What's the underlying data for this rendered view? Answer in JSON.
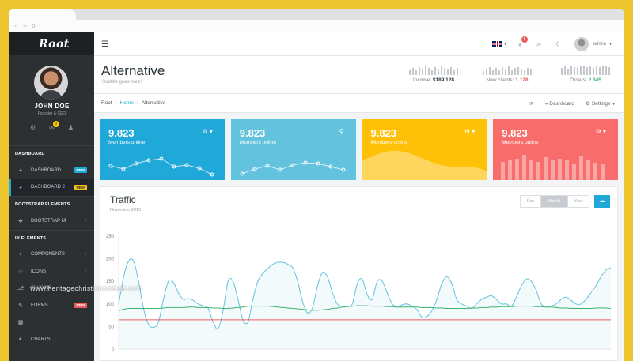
{
  "sidebar": {
    "brand": "Root",
    "profile": {
      "name": "JOHN DOE",
      "role": "Founder & CEO",
      "notification_count": "3"
    },
    "sections": [
      {
        "label": "DASHBOARD"
      },
      {
        "label": "BOOTSTRAP ELEMENTS"
      },
      {
        "label": "UI ELEMENTS"
      }
    ],
    "items": [
      {
        "label": "DASHBOARD",
        "tag": "NEW",
        "tag_color": "#20a8d8",
        "icon": "dashboard-icon"
      },
      {
        "label": "DASHBOARD 2",
        "tag": "NEW",
        "tag_color": "#f0c419",
        "icon": "dashboard-icon"
      },
      {
        "label": "BOOTSTRAP UI",
        "icon": "puzzle-icon"
      },
      {
        "label": "COMPONENTS",
        "icon": "tag-icon"
      },
      {
        "label": "ICONS",
        "icon": "star-icon"
      },
      {
        "label": "PLUGINS",
        "icon": "plug-icon"
      },
      {
        "label": "FORMS",
        "tag": "NEW",
        "tag_color": "#e85c5c",
        "icon": "edit-icon"
      },
      {
        "label": "CHARTS",
        "icon": "chart-icon"
      }
    ]
  },
  "topbar": {
    "notification_count": "5",
    "username": "admin"
  },
  "header": {
    "title": "Alternative",
    "subtitle": "Subtitle goes here!",
    "stats": [
      {
        "label": "Income:",
        "value": "$189.128",
        "color": "#263238"
      },
      {
        "label": "New clients:",
        "value": "1.128",
        "color": "#e85c5c"
      },
      {
        "label": "Orders:",
        "value": "2.345",
        "color": "#3cb371"
      }
    ]
  },
  "breadcrumb": {
    "items": [
      "Root",
      "Home",
      "Alternative"
    ],
    "actions": [
      "Dashboard",
      "Settings"
    ]
  },
  "cards": [
    {
      "value": "9.823",
      "label": "Members online",
      "color": "#20a8d8",
      "icon": "gear-icon"
    },
    {
      "value": "9.823",
      "label": "Members online",
      "color": "#63c2de",
      "icon": "location-pin-icon"
    },
    {
      "value": "9.823",
      "label": "Members online",
      "color": "#ffc107",
      "icon": "gear-icon"
    },
    {
      "value": "9.823",
      "label": "Members online",
      "color": "#f86c6b",
      "icon": "gear-icon"
    }
  ],
  "traffic": {
    "title": "Traffic",
    "subtitle": "November 2015",
    "ranges": [
      "Day",
      "Month",
      "Year"
    ],
    "selected_range": "Month"
  },
  "watermark": "www.heritagechristiancollege.com",
  "chart_data": {
    "type": "line",
    "ylim": [
      0,
      250
    ],
    "yticks": [
      0,
      50,
      100,
      150,
      200,
      250
    ],
    "x": [
      0,
      1,
      2,
      3,
      4,
      5,
      6,
      7,
      8,
      9,
      10,
      11,
      12,
      13,
      14,
      15,
      16,
      17,
      18,
      19,
      20,
      21,
      22,
      23,
      24,
      25,
      26,
      27,
      28,
      29,
      30,
      31,
      32,
      33,
      34,
      35,
      36,
      37,
      38,
      39,
      40,
      41,
      42,
      43,
      44,
      45,
      46,
      47,
      48,
      49,
      50,
      51,
      52,
      53,
      54,
      55,
      56,
      57,
      58,
      59,
      60,
      61,
      62,
      63,
      64,
      65,
      66,
      67,
      68,
      69,
      70,
      71,
      72,
      73,
      74,
      75,
      76,
      77,
      78,
      79,
      80,
      81,
      82,
      83,
      84,
      85,
      86,
      87,
      88,
      89,
      90,
      91,
      92,
      93,
      94,
      95,
      96,
      97,
      98,
      99
    ],
    "series": [
      {
        "values": [
          100,
          160,
          195,
          195,
          150,
          90,
          55,
          48,
          60,
          110,
          150,
          148,
          125,
          110,
          112,
          108,
          100,
          96,
          90,
          60,
          45,
          85,
          150,
          150,
          110,
          65,
          60,
          110,
          150,
          168,
          178,
          188,
          192,
          192,
          188,
          180,
          150,
          105,
          80,
          92,
          140,
          170,
          160,
          125,
          100,
          95,
          95,
          100,
          145,
          155,
          120,
          110,
          150,
          150,
          125,
          100,
          95,
          98,
          100,
          95,
          88,
          70,
          72,
          85,
          110,
          145,
          160,
          145,
          110,
          100,
          95,
          90,
          100,
          110,
          115,
          118,
          110,
          100,
          100,
          95,
          115,
          140,
          155,
          150,
          130,
          100,
          95,
          95,
          100,
          110,
          115,
          108,
          100,
          100,
          110,
          125,
          140,
          160,
          175,
          180
        ],
        "color": "#63c2de",
        "fill": true
      },
      {
        "values": [
          85,
          88,
          90,
          90,
          90,
          90,
          90,
          90,
          90,
          91,
          92,
          92,
          92,
          92,
          93,
          93,
          92,
          92,
          92,
          91,
          91,
          90,
          90,
          91,
          92,
          93,
          95,
          95,
          95,
          95,
          95,
          94,
          93,
          92,
          91,
          90,
          89,
          88,
          87,
          86,
          86,
          87,
          88,
          90,
          91,
          93,
          94,
          95,
          96,
          96,
          96,
          95,
          95,
          95,
          94,
          94,
          93,
          93,
          93,
          93,
          93,
          92,
          92,
          92,
          91,
          91,
          90,
          90,
          90,
          90,
          90,
          91,
          91,
          92,
          92,
          93,
          93,
          94,
          94,
          94,
          95,
          95,
          95,
          95,
          94,
          94,
          93,
          93,
          92,
          91,
          91,
          90,
          90,
          90,
          90,
          90,
          91,
          91,
          91,
          90
        ],
        "color": "#3cb371",
        "fill": false
      },
      {
        "values": [
          65,
          65,
          65,
          65,
          65,
          65,
          65,
          65,
          65,
          65,
          65,
          65,
          65,
          65,
          65,
          65,
          65,
          65,
          65,
          65,
          65,
          65,
          65,
          65,
          65,
          65,
          65,
          65,
          65,
          65,
          65,
          65,
          65,
          65,
          65,
          65,
          65,
          65,
          65,
          65,
          65,
          65,
          65,
          65,
          65,
          65,
          65,
          65,
          65,
          65,
          65,
          65,
          65,
          65,
          65,
          65,
          65,
          65,
          65,
          65,
          65,
          65,
          65,
          65,
          65,
          65,
          65,
          65,
          65,
          65,
          65,
          65,
          65,
          65,
          65,
          65,
          65,
          65,
          65,
          65,
          65,
          65,
          65,
          65,
          65,
          65,
          65,
          65,
          65,
          65,
          65,
          65,
          65,
          65,
          65,
          65,
          65,
          65,
          65,
          65
        ],
        "color": "#e85c5c",
        "fill": false
      }
    ]
  }
}
